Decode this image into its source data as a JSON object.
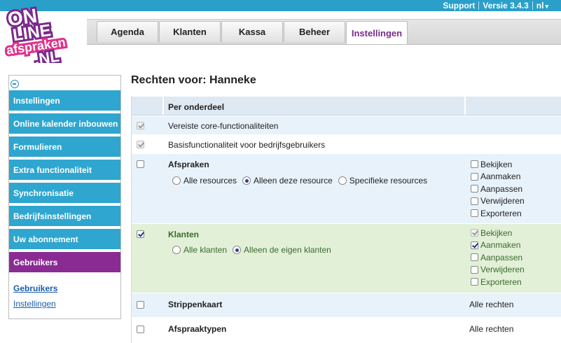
{
  "topbar": {
    "support": "Support",
    "version": "Versie 3.4.3",
    "language": "nl"
  },
  "logo": {
    "line1": "ON",
    "line2": "LINE",
    "line3": "afspraken",
    "line4": ".NL"
  },
  "nav": {
    "tabs": [
      {
        "label": "Agenda"
      },
      {
        "label": "Klanten"
      },
      {
        "label": "Kassa"
      },
      {
        "label": "Beheer"
      },
      {
        "label": "Instellingen"
      }
    ]
  },
  "sidebar": {
    "items": [
      {
        "label": "Instellingen"
      },
      {
        "label": "Online kalender inbouwen"
      },
      {
        "label": "Formulieren"
      },
      {
        "label": "Extra functionaliteit"
      },
      {
        "label": "Synchronisatie"
      },
      {
        "label": "Bedrijfsinstellingen"
      },
      {
        "label": "Uw abonnement"
      },
      {
        "label": "Gebruikers"
      }
    ],
    "sublinks": [
      {
        "label": "Gebruikers"
      },
      {
        "label": "Instellingen"
      }
    ]
  },
  "page": {
    "title": "Rechten voor: Hanneke"
  },
  "rights": {
    "header": "Per onderdeel",
    "rows": {
      "core": {
        "label": "Vereiste core-functionaliteiten"
      },
      "basis": {
        "label": "Basisfunctionaliteit voor bedrijfsgebruikers"
      },
      "afspraken": {
        "label": "Afspraken",
        "radios": [
          "Alle resources",
          "Alleen deze resource",
          "Specifieke resources"
        ],
        "perms": [
          "Bekijken",
          "Aanmaken",
          "Aanpassen",
          "Verwijderen",
          "Exporteren"
        ]
      },
      "klanten": {
        "label": "Klanten",
        "radios": [
          "Alle klanten",
          "Alleen de eigen klanten"
        ],
        "perms": [
          "Bekijken",
          "Aanmaken",
          "Aanpassen",
          "Verwijderen",
          "Exporteren"
        ]
      },
      "strippenkaart": {
        "label": "Strippenkaart",
        "value": "Alle rechten"
      },
      "afspraaktypen": {
        "label": "Afspraaktypen",
        "value": "Alle rechten"
      }
    }
  },
  "colors": {
    "accent": "#8a2b93",
    "sidebar": "#2ea6cf",
    "topbar": "#2a9fc9"
  }
}
